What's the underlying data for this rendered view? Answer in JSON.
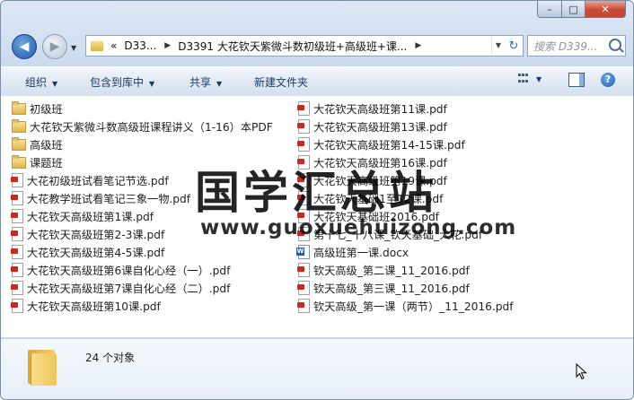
{
  "window": {
    "caption_buttons": {
      "minimize": "–",
      "maximize": "□",
      "close": "✕"
    }
  },
  "nav": {
    "back_icon": "arrow-left-icon",
    "forward_icon": "arrow-right-icon",
    "address_segments": [
      "«",
      "D33...",
      "D3391 大花钦天紫微斗数初级班+高级班+课..."
    ],
    "search_placeholder": "搜索 D339..."
  },
  "toolbar": {
    "organize": "组织",
    "include_in_library": "包含到库中",
    "share": "共享",
    "new_folder": "新建文件夹"
  },
  "files_left": [
    {
      "name": "初级班",
      "type": "folder"
    },
    {
      "name": "大花钦天紫微斗数高级班课程讲义（1-16）本PDF",
      "type": "folder"
    },
    {
      "name": "高级班",
      "type": "folder"
    },
    {
      "name": "课题班",
      "type": "folder"
    },
    {
      "name": "大花初级班试看笔记节选.pdf",
      "type": "pdf"
    },
    {
      "name": "大花教学班试看笔记三象一物.pdf",
      "type": "pdf"
    },
    {
      "name": "大花钦天高级班第1课.pdf",
      "type": "pdf"
    },
    {
      "name": "大花钦天高级班第2-3课.pdf",
      "type": "pdf"
    },
    {
      "name": "大花钦天高级班第4-5课.pdf",
      "type": "pdf"
    },
    {
      "name": "大花钦天高级班第6课自化心经（一）.pdf",
      "type": "pdf"
    },
    {
      "name": "大花钦天高级班第7课自化心经（二）.pdf",
      "type": "pdf"
    },
    {
      "name": "大花钦天高级班第10课.pdf",
      "type": "pdf"
    }
  ],
  "files_right": [
    {
      "name": "大花钦天高级班第11课.pdf",
      "type": "pdf"
    },
    {
      "name": "大花钦天高级班第13课.pdf",
      "type": "pdf"
    },
    {
      "name": "大花钦天高级班第14-15课.pdf",
      "type": "pdf"
    },
    {
      "name": "大花钦天高级班第16课.pdf",
      "type": "pdf"
    },
    {
      "name": "大花钦天高级班第19课.pdf",
      "type": "pdf"
    },
    {
      "name": "大花钦天基础1至12课.pdf",
      "type": "pdf"
    },
    {
      "name": "大花钦天基础班2016.pdf",
      "type": "pdf"
    },
    {
      "name": "第十七_十八课_钦天基础_大花.pdf",
      "type": "pdf"
    },
    {
      "name": "高级班第一课.docx",
      "type": "docx"
    },
    {
      "name": "钦天高级_第二课_11_2016.pdf",
      "type": "pdf"
    },
    {
      "name": "钦天高级_第三课_11_2016.pdf",
      "type": "pdf"
    },
    {
      "name": "钦天高级_第一课（两节）_11_2016.pdf",
      "type": "pdf"
    }
  ],
  "watermark": {
    "text": "国学汇总站",
    "url": "www.guoxuehuizong.com"
  },
  "details": {
    "count": "24 个对象"
  }
}
